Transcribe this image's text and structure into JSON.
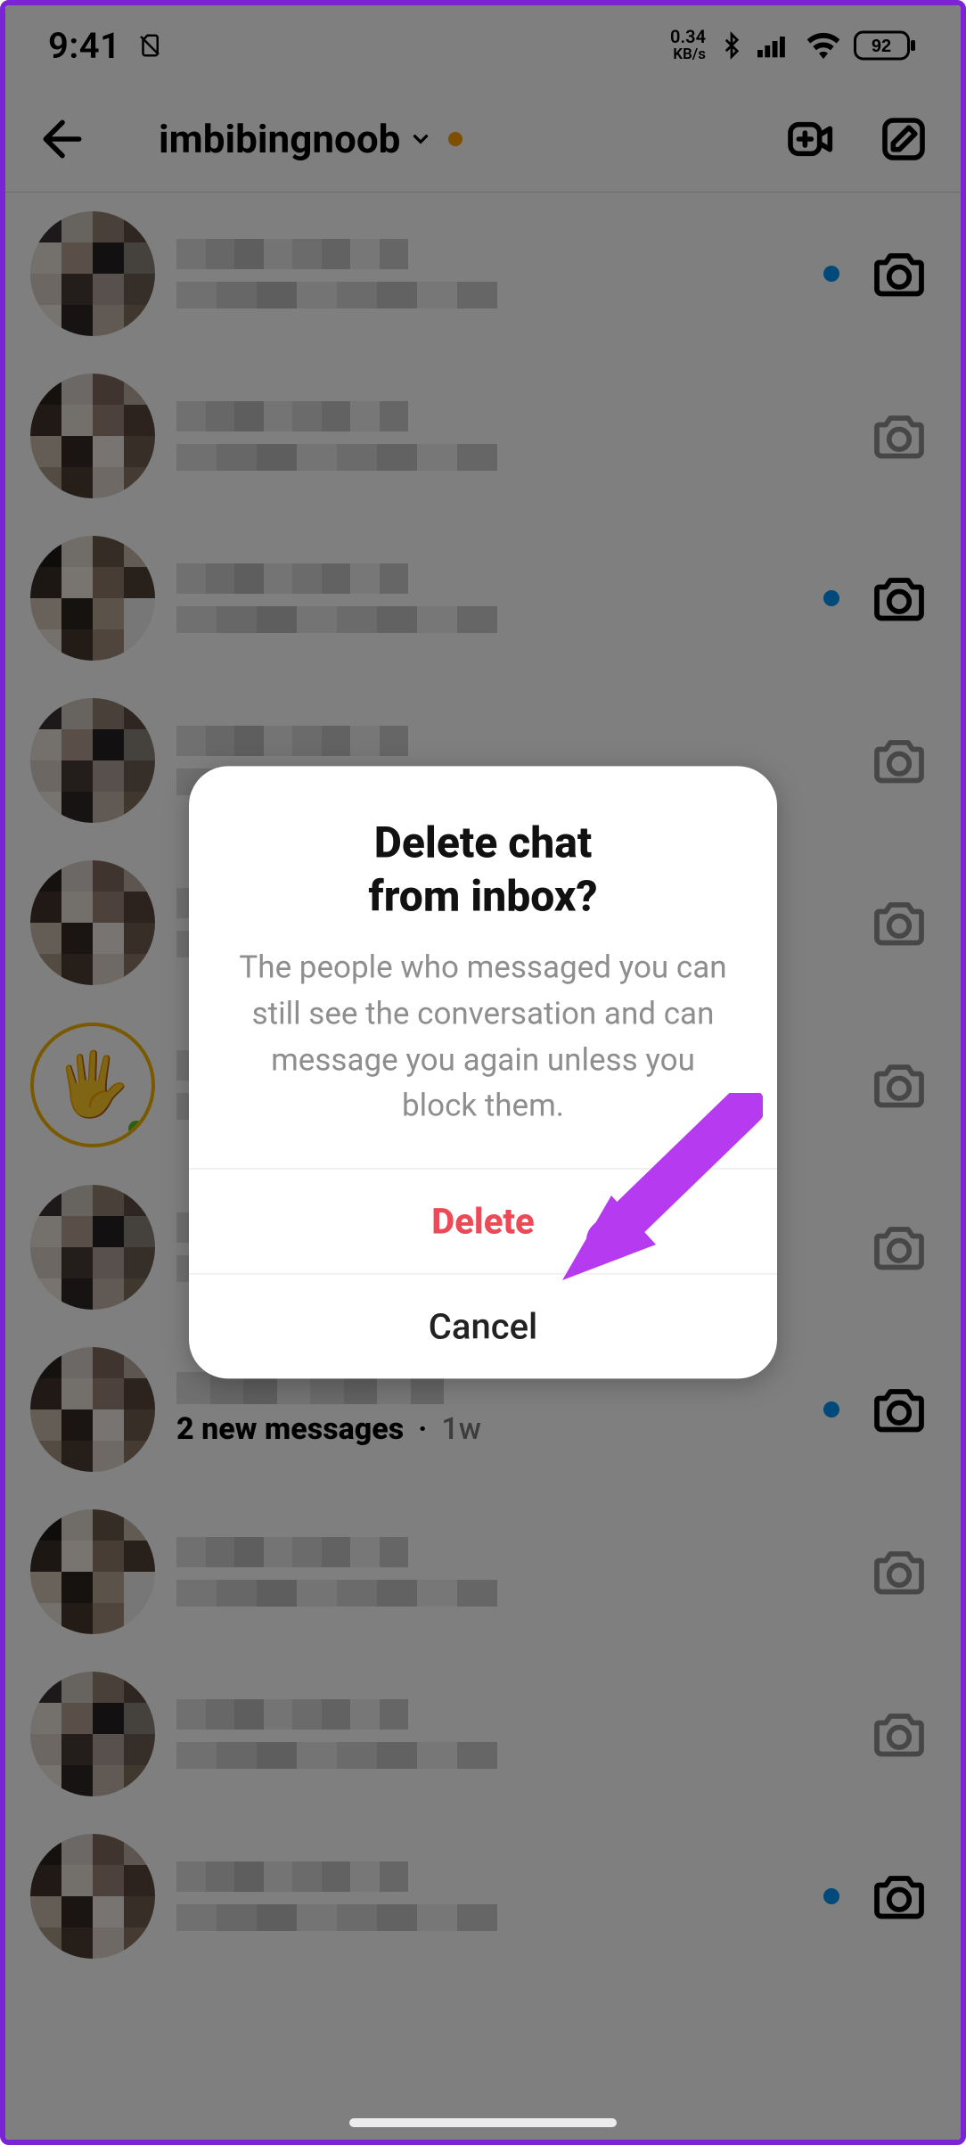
{
  "status": {
    "time": "9:41",
    "net_top": "0.34",
    "net_bot": "KB/s",
    "battery": "92"
  },
  "header": {
    "username": "imbibingnoob"
  },
  "dialog": {
    "title_line1": "Delete chat",
    "title_line2": "from inbox?",
    "description": "The people who messaged you can still see the conversation and can message you again unless you block them.",
    "delete_label": "Delete",
    "cancel_label": "Cancel"
  },
  "rows": [
    {
      "unread": true,
      "cam_dim": false
    },
    {
      "unread": false,
      "cam_dim": true
    },
    {
      "unread": true,
      "cam_dim": false
    },
    {
      "unread": false,
      "cam_dim": true
    },
    {
      "unread": false,
      "cam_dim": true
    },
    {
      "unread": false,
      "cam_dim": true,
      "hand_avatar": true
    },
    {
      "unread": false,
      "cam_dim": true
    },
    {
      "unread": true,
      "cam_dim": false,
      "bold_message": "2 new messages",
      "time": "1w"
    },
    {
      "unread": false,
      "cam_dim": true
    },
    {
      "unread": false,
      "cam_dim": true
    },
    {
      "unread": true,
      "cam_dim": false
    }
  ]
}
